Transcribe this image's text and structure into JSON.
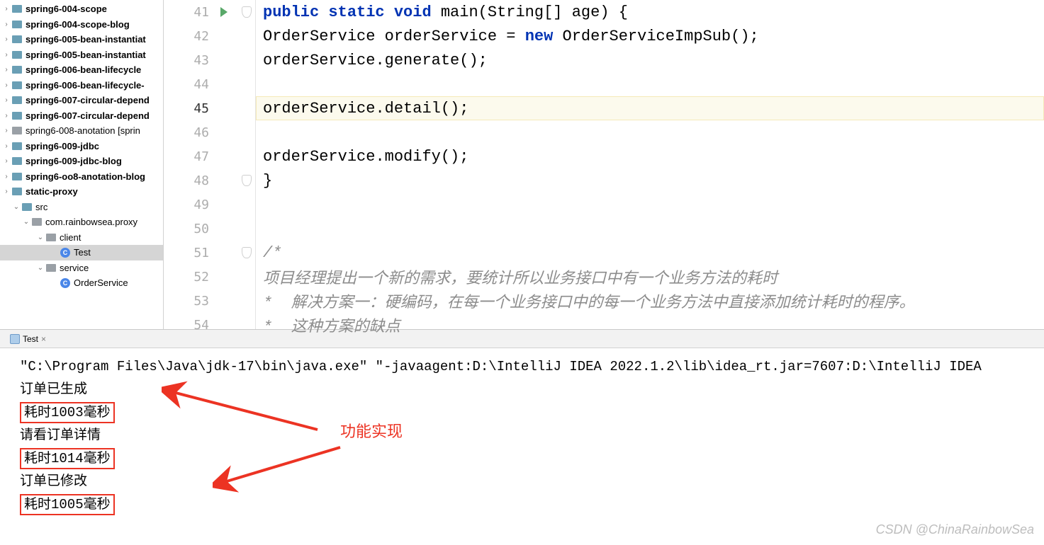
{
  "tree": [
    {
      "icon": "folder",
      "label": "spring6-004-scope",
      "indent": 0,
      "bold": true
    },
    {
      "icon": "folder",
      "label": "spring6-004-scope-blog",
      "indent": 0,
      "bold": true
    },
    {
      "icon": "folder",
      "label": "spring6-005-bean-instantiat",
      "indent": 0,
      "bold": true
    },
    {
      "icon": "folder",
      "label": "spring6-005-bean-instantiat",
      "indent": 0,
      "bold": true
    },
    {
      "icon": "folder",
      "label": "spring6-006-bean-lifecycle",
      "indent": 0,
      "bold": true
    },
    {
      "icon": "folder",
      "label": "spring6-006-bean-lifecycle-",
      "indent": 0,
      "bold": true
    },
    {
      "icon": "folder",
      "label": "spring6-007-circular-depend",
      "indent": 0,
      "bold": true
    },
    {
      "icon": "folder",
      "label": "spring6-007-circular-depend",
      "indent": 0,
      "bold": true
    },
    {
      "icon": "folder-gray",
      "label": "spring6-008-anotation [sprin",
      "indent": 0,
      "bold": false
    },
    {
      "icon": "folder",
      "label": "spring6-009-jdbc",
      "indent": 0,
      "bold": true
    },
    {
      "icon": "folder",
      "label": "spring6-009-jdbc-blog",
      "indent": 0,
      "bold": true
    },
    {
      "icon": "folder",
      "label": "spring6-oo8-anotation-blog",
      "indent": 0,
      "bold": true
    },
    {
      "icon": "folder",
      "label": "static-proxy",
      "indent": 0,
      "bold": true
    },
    {
      "icon": "folder",
      "label": "src",
      "indent": 1,
      "bold": false,
      "chevron": "v"
    },
    {
      "icon": "folder-gray",
      "label": "com.rainbowsea.proxy",
      "indent": 2,
      "bold": false,
      "chevron": "v"
    },
    {
      "icon": "folder-gray",
      "label": "client",
      "indent": 3,
      "bold": false,
      "chevron": "v"
    },
    {
      "icon": "class",
      "label": "Test",
      "indent": 4,
      "bold": false,
      "selected": true
    },
    {
      "icon": "folder-gray",
      "label": "service",
      "indent": 3,
      "bold": false,
      "chevron": "v"
    },
    {
      "icon": "class",
      "label": "OrderService",
      "indent": 4,
      "bold": false
    }
  ],
  "gutter": {
    "lines": [
      "41",
      "42",
      "43",
      "44",
      "45",
      "46",
      "47",
      "48",
      "49",
      "50",
      "51",
      "52",
      "53",
      "54"
    ],
    "current": "45",
    "run_on": "41",
    "shields": [
      "41",
      "48",
      "51"
    ]
  },
  "code": {
    "l41": {
      "pre": "    ",
      "kw1": "public ",
      "kw2": "static ",
      "kw3": "void ",
      "mth": "main",
      "p1": "(",
      "ty": "String",
      "arr": "[] ",
      "arg": "age",
      "p2": ") {"
    },
    "l42": {
      "pre": "        ",
      "ty": "OrderService ",
      "id": "orderService ",
      "eq": "= ",
      "kw": "new ",
      "cls": "OrderServiceImpSub",
      "call": "();"
    },
    "l43": {
      "pre": "        ",
      "id": "orderService",
      ".": ".",
      "mth": "generate",
      "call": "();"
    },
    "l44": "",
    "l45": {
      "pre": "        ",
      "id": "orderService",
      ".": ".",
      "mth": "detail",
      "call": "();"
    },
    "l46": "",
    "l47": {
      "pre": "        ",
      "id": "orderService",
      ".": ".",
      "mth": "modify",
      "call": "();"
    },
    "l48": {
      "pre": "    ",
      "b": "}"
    },
    "l49": "",
    "l50": "",
    "l51": {
      "pre": "    ",
      "cm": "/*"
    },
    "l52": {
      "pre": "     ",
      "cm": "项目经理提出一个新的需求，要统计所以业务接口中有一个业务方法的耗时"
    },
    "l53": {
      "pre": "   ",
      "cm": "*  解决方案一：硬编码，在每一个业务接口中的每一个业务方法中直接添加统计耗时的程序。"
    },
    "l54": {
      "pre": "   ",
      "cm": "*  这种方案的缺点"
    }
  },
  "panel": {
    "tab_label": "Test"
  },
  "console": {
    "cmd": "\"C:\\Program Files\\Java\\jdk-17\\bin\\java.exe\" \"-javaagent:D:\\IntelliJ IDEA 2022.1.2\\lib\\idea_rt.jar=7607:D:\\IntelliJ IDEA ",
    "lines": [
      {
        "text": "订单已生成",
        "boxed": false
      },
      {
        "text": "耗时1003毫秒",
        "boxed": true
      },
      {
        "text": "请看订单详情",
        "boxed": false
      },
      {
        "text": "耗时1014毫秒",
        "boxed": true
      },
      {
        "text": "订单已修改",
        "boxed": false
      },
      {
        "text": "耗时1005毫秒",
        "boxed": true
      }
    ],
    "annotation": "功能实现"
  },
  "watermark": "CSDN @ChinaRainbowSea"
}
